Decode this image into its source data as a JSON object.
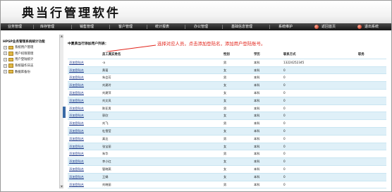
{
  "app": {
    "title": "典当行管理软件"
  },
  "nav": {
    "items": [
      "业务管理",
      "库存管理",
      "销售管理",
      "客户管理",
      "统计报表",
      "办公管理",
      "基础信息管理",
      "系统维护"
    ],
    "home_label": "返回首页",
    "logout_label": "退出系统"
  },
  "sidebar": {
    "title": "HPSP业务管理系统统计功能",
    "items": [
      "系统用户管理",
      "用户权限管理",
      "用户登陆统计",
      "系统操作日志",
      "数据库备份"
    ],
    "scroll_up": "▲",
    "scroll_down": "▼"
  },
  "main": {
    "caption": "中夏典当行添加用户列表：",
    "annotation": "选择对应人员，点击添加登陆名，添加用户登陆账号。",
    "columns": [
      "员工真实姓名",
      "性别",
      "学历",
      "联系方式",
      "职务"
    ],
    "rows": [
      {
        "action": "添加登陆名",
        "name": "-a",
        "gender": "男",
        "edu": "本科",
        "phone": "13224252345",
        "position": ""
      },
      {
        "action": "添加登陆名",
        "name": "黄菊",
        "gender": "女",
        "edu": "本科",
        "phone": "0",
        "position": ""
      },
      {
        "action": "添加登陆名",
        "name": "朱会芳",
        "gender": "男",
        "edu": "本科",
        "phone": "0",
        "position": ""
      },
      {
        "action": "添加登陆名",
        "name": "刘建玲",
        "gender": "女",
        "edu": "本科",
        "phone": "0",
        "position": ""
      },
      {
        "action": "添加登陆名",
        "name": "刘建萍",
        "gender": "女",
        "edu": "本科",
        "phone": "0",
        "position": ""
      },
      {
        "action": "添加登陆名",
        "name": "刘文凤",
        "gender": "女",
        "edu": "本科",
        "phone": "0",
        "position": ""
      },
      {
        "action": "添加登陆名",
        "name": "陈亚男",
        "gender": "男",
        "edu": "本科",
        "phone": "0",
        "position": ""
      },
      {
        "action": "添加登陆名",
        "name": "郭欣",
        "gender": "女",
        "edu": "本科",
        "phone": "0",
        "position": ""
      },
      {
        "action": "添加登陆名",
        "name": "刘飞",
        "gender": "男",
        "edu": "本科",
        "phone": "0",
        "position": ""
      },
      {
        "action": "添加登陆名",
        "name": "杜雪莹",
        "gender": "女",
        "edu": "本科",
        "phone": "0",
        "position": ""
      },
      {
        "action": "添加登陆名",
        "name": "真达",
        "gender": "男",
        "edu": "本科",
        "phone": "0",
        "position": ""
      },
      {
        "action": "添加登陆名",
        "name": "张宝丽",
        "gender": "女",
        "edu": "本科",
        "phone": "0",
        "position": ""
      },
      {
        "action": "添加登陆名",
        "name": "朱华",
        "gender": "男",
        "edu": "本科",
        "phone": "0",
        "position": ""
      },
      {
        "action": "添加登陆名",
        "name": "李小红",
        "gender": "女",
        "edu": "本科",
        "phone": "0",
        "position": ""
      },
      {
        "action": "添加登陆名",
        "name": "管晓燕",
        "gender": "女",
        "edu": "本科",
        "phone": "0",
        "position": ""
      },
      {
        "action": "添加登陆名",
        "name": "王娟",
        "gender": "女",
        "edu": "本科",
        "phone": "0",
        "position": ""
      },
      {
        "action": "添加登陆名",
        "name": "刘晓丽",
        "gender": "男",
        "edu": "本科",
        "phone": "0",
        "position": ""
      }
    ]
  },
  "colors": {
    "nav_bg": "#1f1f1f",
    "row_alt": "#dff0f8",
    "annotation": "#e2241b",
    "link": "#1e3a8a"
  }
}
